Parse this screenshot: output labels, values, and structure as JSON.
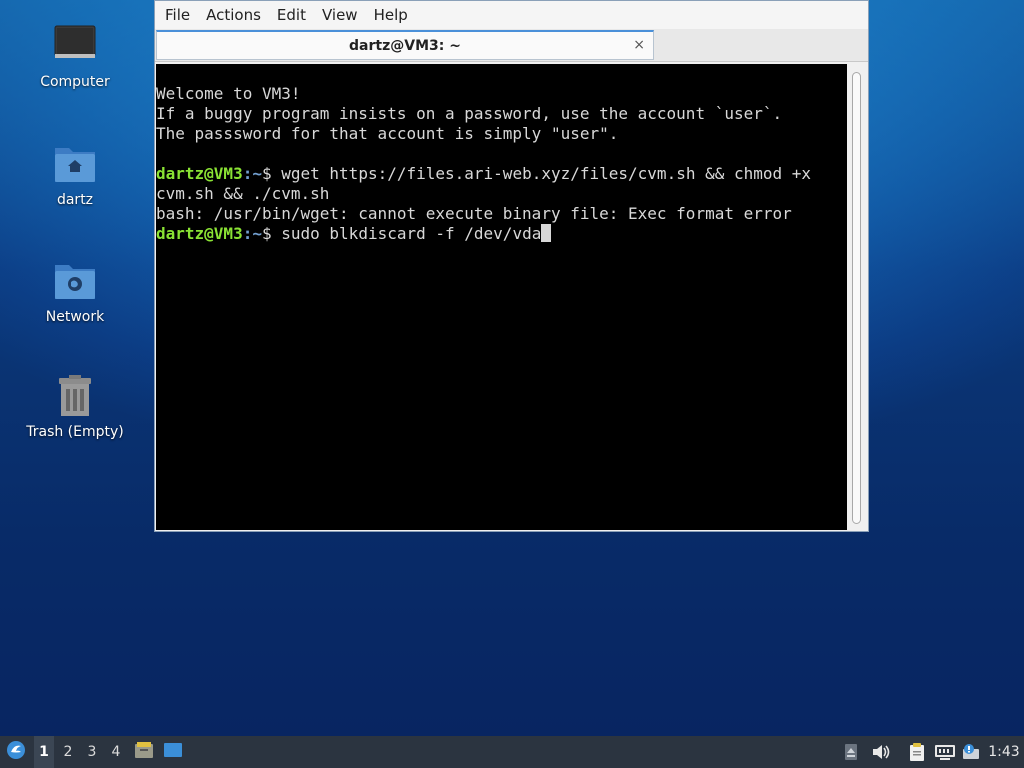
{
  "desktop": {
    "icons": [
      {
        "label": "Computer"
      },
      {
        "label": "dartz"
      },
      {
        "label": "Network"
      },
      {
        "label": "Trash (Empty)"
      }
    ]
  },
  "terminal": {
    "menu": [
      "File",
      "Actions",
      "Edit",
      "View",
      "Help"
    ],
    "tab_title": "dartz@VM3: ~",
    "tab_close": "×",
    "lines": {
      "l1": "Welcome to VM3!",
      "l2": "If a buggy program insists on a password, use the account `user`.",
      "l3": "The passsword for that account is simply \"user\".",
      "prompt_user": "dartz@VM3",
      "prompt_colon": ":",
      "prompt_path": "~",
      "prompt_dollar": "$ ",
      "cmd1a": "wget https://files.ari-web.xyz/files/cvm.sh && chmod +x",
      "cmd1b": "cvm.sh && ./cvm.sh",
      "err": "bash: /usr/bin/wget: cannot execute binary file: Exec format error",
      "cmd2": "sudo blkdiscard -f /dev/vda"
    }
  },
  "taskbar": {
    "workspaces": [
      "1",
      "2",
      "3",
      "4"
    ],
    "active_workspace": "1",
    "clock": "1:43"
  },
  "colors": {
    "prompt_user": "#8ae234",
    "prompt_path": "#729fcf",
    "taskbar_bg": "#2b3440"
  }
}
